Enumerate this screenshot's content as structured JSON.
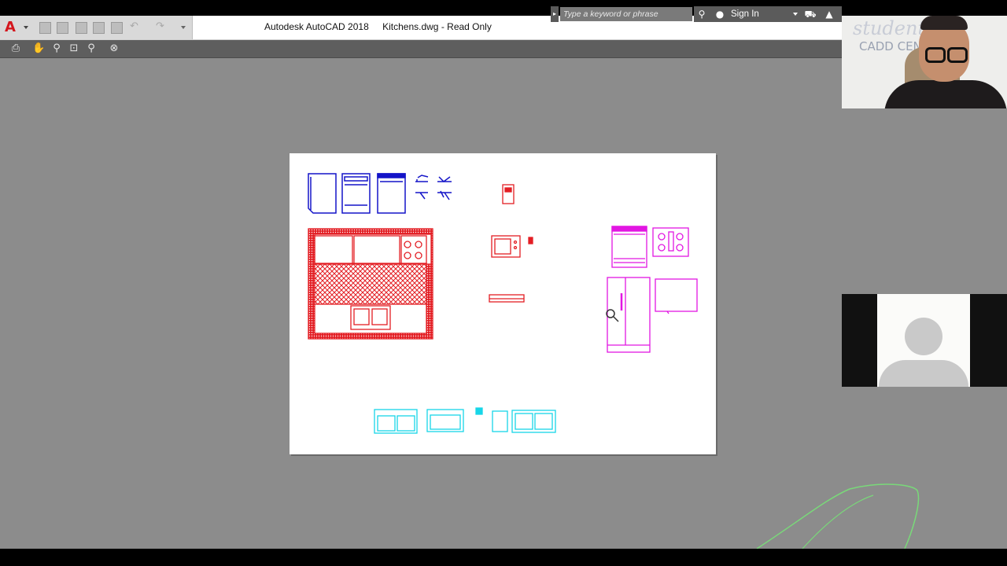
{
  "app": {
    "product": "Autodesk AutoCAD 2018",
    "document": "Kitchens.dwg - Read Only",
    "logo": "A"
  },
  "search": {
    "placeholder": "Type a keyword or phrase"
  },
  "account": {
    "signin_label": "Sign In"
  },
  "webcam": {
    "whiteboard_text_1": "student.C",
    "whiteboard_text_2": "CADD CEN"
  },
  "colors": {
    "blue": "#1414c8",
    "red": "#e31e24",
    "magenta": "#e216e2",
    "cyan": "#17d6e8",
    "accent": "#d4161d"
  },
  "icons": [
    "autocad-logo-icon",
    "new-icon",
    "open-icon",
    "save-icon",
    "saveas-icon",
    "plot-icon",
    "undo-icon",
    "redo-icon",
    "dropdown-icon",
    "binoculars-icon",
    "user-icon",
    "cart-icon",
    "exchange-icon",
    "print-icon",
    "pan-icon",
    "zoom-icon",
    "zoom-window-icon",
    "zoom-previous-icon",
    "close-icon",
    "magnifier-cursor-icon"
  ]
}
